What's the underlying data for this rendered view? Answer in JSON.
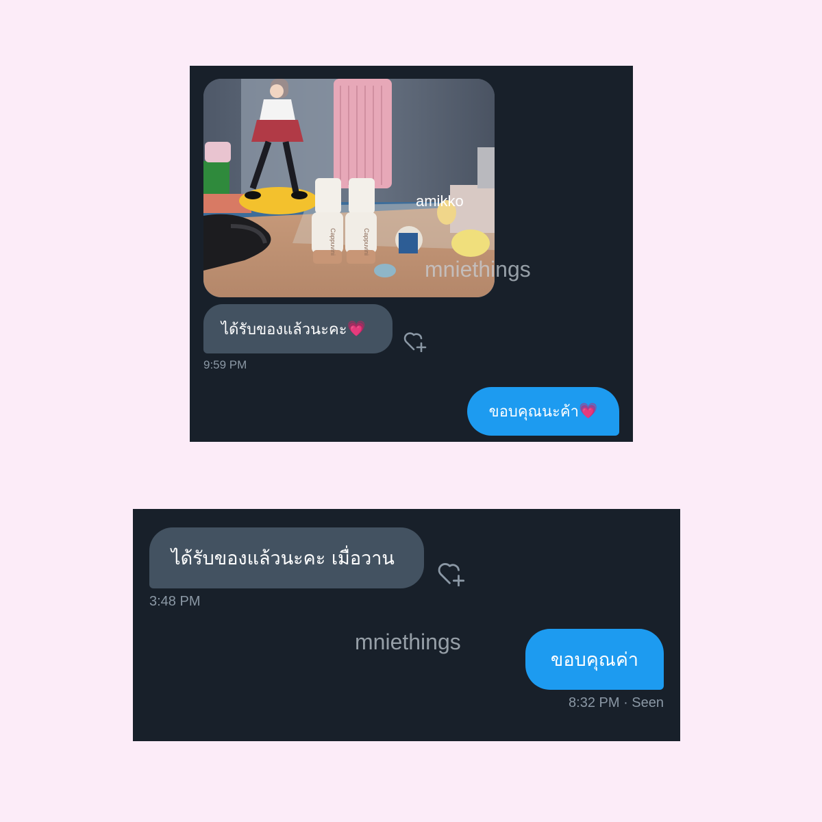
{
  "screenshot1": {
    "watermark": "mniethings",
    "received": {
      "text": "ได้รับของแล้วนะคะ",
      "emoji": "💗",
      "time": "9:59 PM"
    },
    "sent": {
      "text": "ขอบคุณนะค้า",
      "emoji": "💗"
    },
    "photo": {
      "tube_label": "Cappuvini",
      "mat_text": "amikko"
    }
  },
  "screenshot2": {
    "watermark": "mniethings",
    "received": {
      "text": "ได้รับของแล้วนะคะ เมื่อวาน",
      "time": "3:48 PM"
    },
    "sent": {
      "text": "ขอบคุณค่า",
      "time": "8:32 PM",
      "status": "· Seen"
    }
  },
  "colors": {
    "page_background": "#fcecf8",
    "chat_background": "#18202a",
    "incoming_bubble": "#435261",
    "outgoing_bubble": "#1d9bf0",
    "timestamp": "#8b98a5"
  },
  "icons": [
    "heart-plus-icon"
  ]
}
